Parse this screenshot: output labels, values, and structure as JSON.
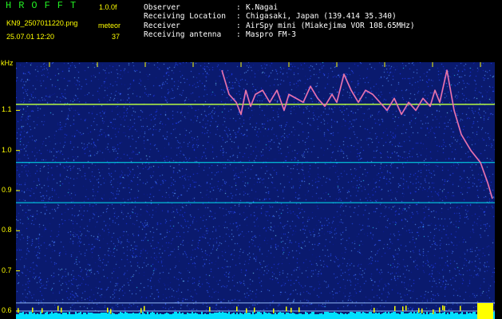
{
  "header": {
    "logo": "HROFFT",
    "version": "1.0.0f",
    "filename": "KN9_2507011220.png",
    "meteor_label": "meteor",
    "timestamp": "25.07.01 12:20",
    "meteor_count": "37",
    "info": [
      {
        "label": "Observer",
        "value": "K.Nagai"
      },
      {
        "label": "Receiving Location",
        "value": "Chigasaki, Japan (139.414 35.340)"
      },
      {
        "label": "Receiver",
        "value": "AirSpy mini (Miakejima VOR 108.65MHz)"
      },
      {
        "label": "Receiving antenna",
        "value": "Maspro FM-3"
      }
    ]
  },
  "colors": {
    "background": "#000000",
    "plot_bg": "#0a1a6e",
    "line": "#e050e0",
    "carrier": "#00ffff",
    "label": "#ffff00"
  },
  "chart_data": {
    "type": "heatmap",
    "ylabel": "kHz",
    "y_ticks": [
      "1.1",
      "1.0",
      "0.9",
      "0.8",
      "0.7",
      "0.6"
    ],
    "ylim": [
      0.58,
      1.22
    ],
    "x_ticks": [
      "1221",
      "1222",
      "1223",
      "1224",
      "1225",
      "1226",
      "1227",
      "1228",
      "1229",
      "1230"
    ],
    "xlim": [
      1220.3,
      1230.3
    ],
    "horizontal_lines_khz": [
      1.115,
      0.97,
      0.87,
      0.62,
      0.6
    ],
    "series": [
      {
        "x": [
          1224.6,
          1224.75,
          1224.9,
          1225.0,
          1225.1,
          1225.2,
          1225.3,
          1225.45,
          1225.6,
          1225.75,
          1225.9,
          1226.0,
          1226.15,
          1226.3,
          1226.45,
          1226.6,
          1226.75,
          1226.9,
          1227.0,
          1227.15,
          1227.3,
          1227.45,
          1227.6,
          1227.75,
          1227.9,
          1228.05,
          1228.2,
          1228.35,
          1228.5,
          1228.65,
          1228.8,
          1228.95,
          1229.05,
          1229.15,
          1229.3,
          1229.45,
          1229.6,
          1229.8,
          1230.0,
          1230.15,
          1230.25
        ],
        "y": [
          1.2,
          1.14,
          1.12,
          1.09,
          1.15,
          1.11,
          1.14,
          1.15,
          1.12,
          1.15,
          1.1,
          1.14,
          1.13,
          1.12,
          1.16,
          1.13,
          1.11,
          1.14,
          1.12,
          1.19,
          1.15,
          1.12,
          1.15,
          1.14,
          1.12,
          1.1,
          1.13,
          1.09,
          1.12,
          1.1,
          1.13,
          1.11,
          1.15,
          1.12,
          1.2,
          1.1,
          1.04,
          1.0,
          0.97,
          0.92,
          0.88
        ]
      }
    ]
  }
}
